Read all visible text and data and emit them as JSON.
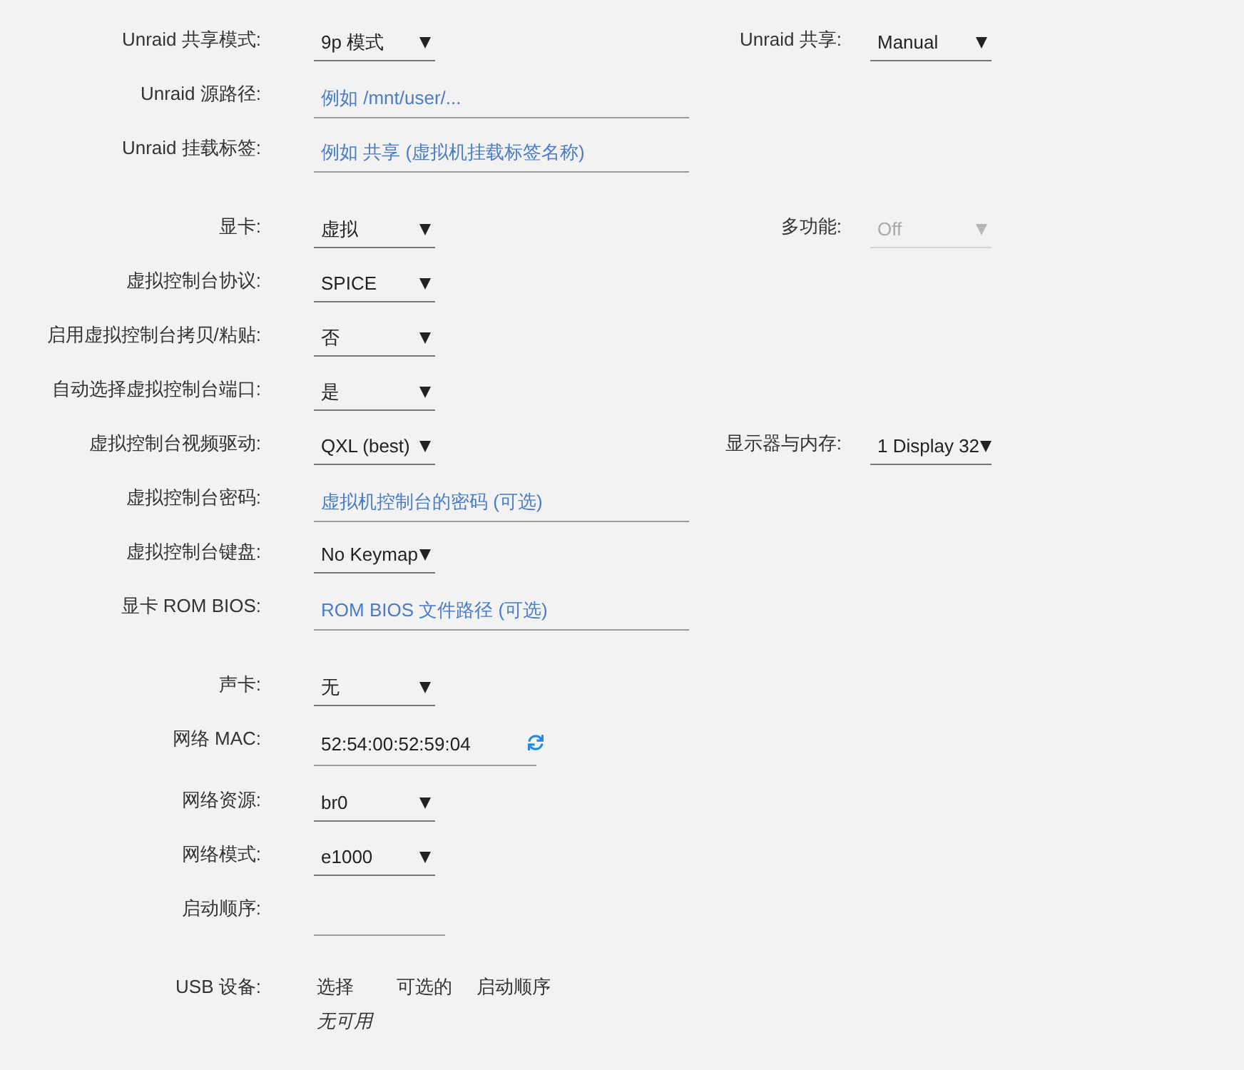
{
  "groups": [
    {
      "rows": [
        {
          "kind": "select",
          "label": "Unraid 共享模式:",
          "value": "9p 模式",
          "side": {
            "label": "Unraid 共享:",
            "value": "Manual",
            "disabled": false
          }
        },
        {
          "kind": "text",
          "label": "Unraid 源路径:",
          "placeholder": "例如 /mnt/user/..."
        },
        {
          "kind": "text",
          "label": "Unraid 挂载标签:",
          "placeholder": "例如 共享 (虚拟机挂载标签名称)"
        }
      ]
    },
    {
      "rows": [
        {
          "kind": "select",
          "label": "显卡:",
          "value": "虚拟",
          "side": {
            "label": "多功能:",
            "value": "Off",
            "disabled": true
          }
        },
        {
          "kind": "select",
          "label": "虚拟控制台协议:",
          "value": "SPICE"
        },
        {
          "kind": "select",
          "label": "启用虚拟控制台拷贝/粘贴:",
          "value": "否"
        },
        {
          "kind": "select",
          "label": "自动选择虚拟控制台端口:",
          "value": "是"
        },
        {
          "kind": "select",
          "label": "虚拟控制台视频驱动:",
          "value": "QXL (best)",
          "side": {
            "label": "显示器与内存:",
            "value": "1 Display 32",
            "disabled": false
          }
        },
        {
          "kind": "text",
          "label": "虚拟控制台密码:",
          "placeholder": "虚拟机控制台的密码 (可选)"
        },
        {
          "kind": "select",
          "label": "虚拟控制台键盘:",
          "value": "No Keymap"
        },
        {
          "kind": "text",
          "label": "显卡 ROM BIOS:",
          "placeholder": "ROM BIOS 文件路径 (可选)"
        }
      ]
    },
    {
      "rows": [
        {
          "kind": "select",
          "label": "声卡:",
          "value": "无"
        },
        {
          "kind": "mac",
          "label": "网络 MAC:",
          "value": "52:54:00:52:59:04"
        },
        {
          "kind": "select",
          "label": "网络资源:",
          "value": "br0"
        },
        {
          "kind": "select",
          "label": "网络模式:",
          "value": "e1000"
        },
        {
          "kind": "short",
          "label": "启动顺序:"
        }
      ]
    },
    {
      "rows": [
        {
          "kind": "usb",
          "label": "USB 设备:",
          "columns": [
            "选择",
            "可选的",
            "启动顺序"
          ],
          "empty_note": "无可用"
        }
      ]
    }
  ]
}
